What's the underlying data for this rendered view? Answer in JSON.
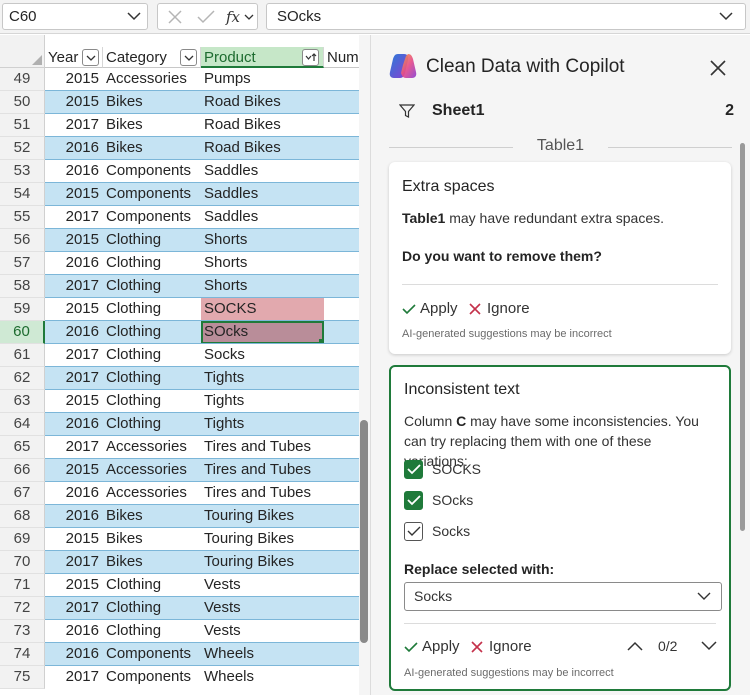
{
  "formula_bar": {
    "name_box": "C60",
    "formula": "SOcks"
  },
  "grid": {
    "headers": [
      {
        "label": "Year",
        "filter": true,
        "selected": false
      },
      {
        "label": "Category",
        "filter": true,
        "selected": false
      },
      {
        "label": "Product",
        "filter": true,
        "selected": true,
        "sorted": true
      },
      {
        "label": "Num",
        "filter": false,
        "selected": false
      }
    ],
    "rows": [
      {
        "n": "49",
        "year": "2015",
        "cat": "Accessories",
        "prod": "Pumps",
        "band": false
      },
      {
        "n": "50",
        "year": "2015",
        "cat": "Bikes",
        "prod": "Road Bikes",
        "band": true
      },
      {
        "n": "51",
        "year": "2017",
        "cat": "Bikes",
        "prod": "Road Bikes",
        "band": false
      },
      {
        "n": "52",
        "year": "2016",
        "cat": "Bikes",
        "prod": "Road Bikes",
        "band": true
      },
      {
        "n": "53",
        "year": "2016",
        "cat": "Components",
        "prod": "Saddles",
        "band": false
      },
      {
        "n": "54",
        "year": "2015",
        "cat": "Components",
        "prod": "Saddles",
        "band": true
      },
      {
        "n": "55",
        "year": "2017",
        "cat": "Components",
        "prod": "Saddles",
        "band": false
      },
      {
        "n": "56",
        "year": "2015",
        "cat": "Clothing",
        "prod": "Shorts",
        "band": true
      },
      {
        "n": "57",
        "year": "2016",
        "cat": "Clothing",
        "prod": "Shorts",
        "band": false
      },
      {
        "n": "58",
        "year": "2017",
        "cat": "Clothing",
        "prod": "Shorts",
        "band": true
      },
      {
        "n": "59",
        "year": "2015",
        "cat": "Clothing",
        "prod": "SOCKS",
        "band": false,
        "hl": "hl"
      },
      {
        "n": "60",
        "year": "2016",
        "cat": "Clothing",
        "prod": "SOcks",
        "band": true,
        "hl": "hl-sel",
        "active": true
      },
      {
        "n": "61",
        "year": "2017",
        "cat": "Clothing",
        "prod": "Socks",
        "band": false
      },
      {
        "n": "62",
        "year": "2017",
        "cat": "Clothing",
        "prod": "Tights",
        "band": true
      },
      {
        "n": "63",
        "year": "2015",
        "cat": "Clothing",
        "prod": "Tights",
        "band": false
      },
      {
        "n": "64",
        "year": "2016",
        "cat": "Clothing",
        "prod": "Tights",
        "band": true
      },
      {
        "n": "65",
        "year": "2017",
        "cat": "Accessories",
        "prod": "Tires and Tubes",
        "band": false
      },
      {
        "n": "66",
        "year": "2015",
        "cat": "Accessories",
        "prod": "Tires and Tubes",
        "band": true
      },
      {
        "n": "67",
        "year": "2016",
        "cat": "Accessories",
        "prod": "Tires and Tubes",
        "band": false
      },
      {
        "n": "68",
        "year": "2016",
        "cat": "Bikes",
        "prod": "Touring Bikes",
        "band": true
      },
      {
        "n": "69",
        "year": "2015",
        "cat": "Bikes",
        "prod": "Touring Bikes",
        "band": false
      },
      {
        "n": "70",
        "year": "2017",
        "cat": "Bikes",
        "prod": "Touring Bikes",
        "band": true
      },
      {
        "n": "71",
        "year": "2015",
        "cat": "Clothing",
        "prod": "Vests",
        "band": false
      },
      {
        "n": "72",
        "year": "2017",
        "cat": "Clothing",
        "prod": "Vests",
        "band": true
      },
      {
        "n": "73",
        "year": "2016",
        "cat": "Clothing",
        "prod": "Vests",
        "band": false
      },
      {
        "n": "74",
        "year": "2016",
        "cat": "Components",
        "prod": "Wheels",
        "band": true
      },
      {
        "n": "75",
        "year": "2017",
        "cat": "Components",
        "prod": "Wheels",
        "band": false
      }
    ]
  },
  "pane": {
    "title": "Clean Data with Copilot",
    "sheet_name": "Sheet1",
    "sheet_count": "2",
    "table_label": "Table1",
    "card1": {
      "title": "Extra spaces",
      "table_ref": "Table1",
      "text": " may have redundant extra spaces.",
      "question": "Do you want to remove them?",
      "apply": "Apply",
      "ignore": "Ignore",
      "disclaimer": "AI-generated suggestions may be incorrect"
    },
    "card2": {
      "title": "Inconsistent text",
      "text_pre": "Column ",
      "column": "C",
      "text_post": " may have some inconsistencies. You can try replacing them with one of these variations:",
      "options": [
        {
          "label": "SOCKS",
          "checked": true
        },
        {
          "label": "SOcks",
          "checked": true
        },
        {
          "label": "Socks",
          "checked": false
        }
      ],
      "replace_label": "Replace selected with:",
      "replace_value": "Socks",
      "apply": "Apply",
      "ignore": "Ignore",
      "pager": "0/2",
      "disclaimer": "AI-generated suggestions may be incorrect"
    }
  },
  "colors": {
    "accent_green": "#1f7a3a",
    "band_blue": "#c5e3f3",
    "highlight_red": "#e2a9ae",
    "ignore_red": "#c4314b"
  },
  "icons": [
    "chevron-down-icon",
    "cancel-x-icon",
    "confirm-check-icon",
    "fx-icon",
    "copilot-logo-icon",
    "close-icon",
    "filter-funnel-icon",
    "apply-check-icon",
    "ignore-x-icon",
    "chevron-up-icon"
  ]
}
